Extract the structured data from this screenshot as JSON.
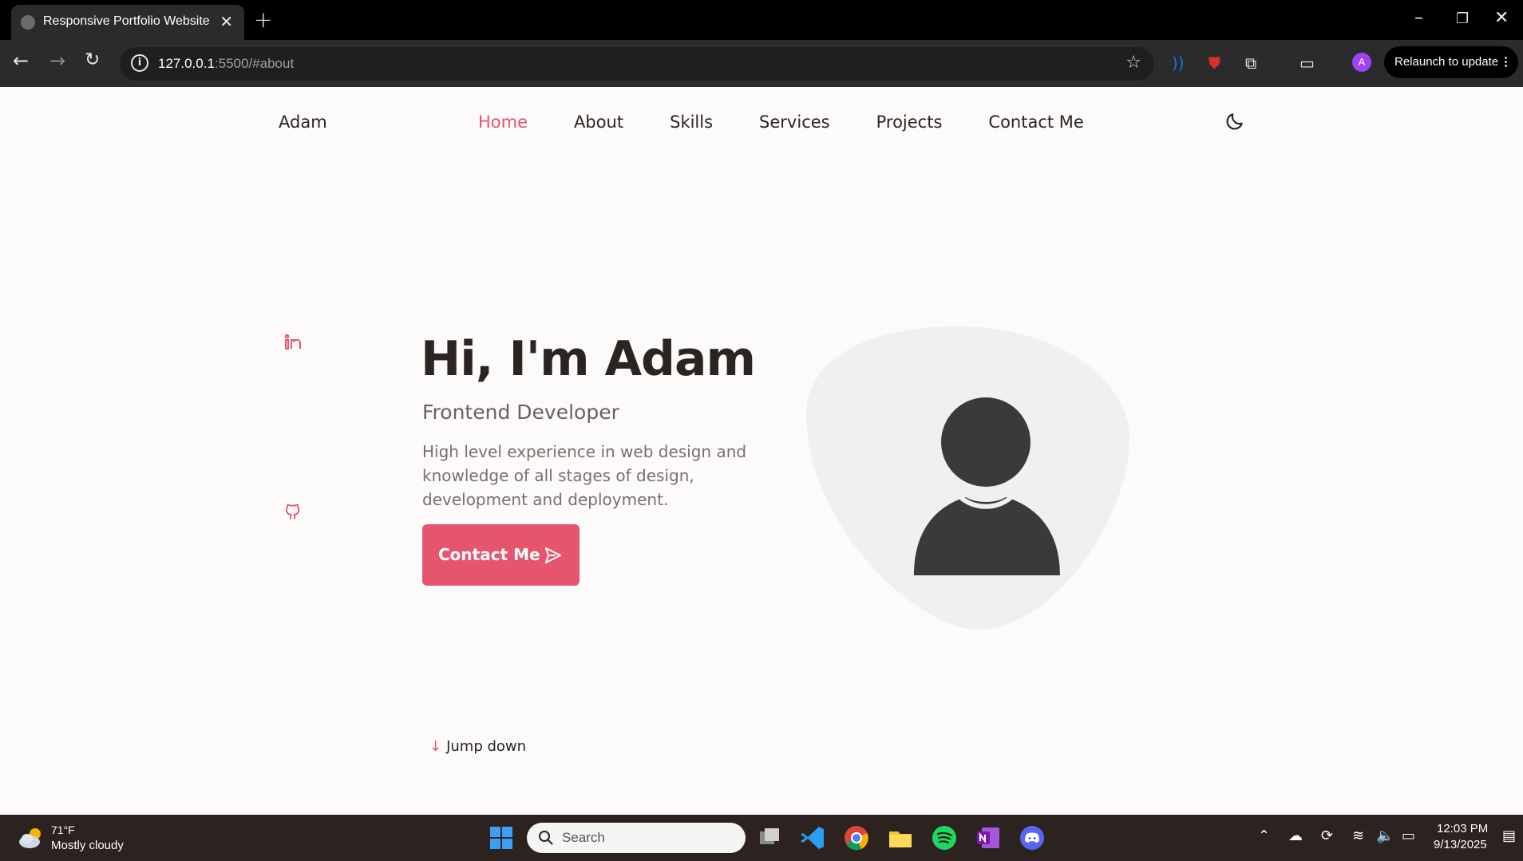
{
  "browser": {
    "tab_title": "Responsive Portfolio Website",
    "url_host": "127.0.0.1",
    "url_rest": ":5500/#about",
    "relaunch_label": "Relaunch to update",
    "profile_initial": "A"
  },
  "site": {
    "logo": "Adam",
    "nav": [
      "Home",
      "About",
      "Skills",
      "Services",
      "Projects",
      "Contact Me"
    ],
    "active_nav": "Home"
  },
  "hero": {
    "title": "Hi, I'm Adam",
    "subtitle": "Frontend Developer",
    "description": "High level experience in web design and knowledge of all stages of design, development and deployment.",
    "cta_label": "Contact Me",
    "scroll_label": "Jump down"
  },
  "taskbar": {
    "weather_temp": "71°F",
    "weather_condition": "Mostly cloudy",
    "search_placeholder": "Search",
    "time": "12:03 PM",
    "date": "9/13/2025"
  },
  "colors": {
    "accent": "#e5566e",
    "text": "#2a2523",
    "page_bg": "#fcfbfa",
    "blob": "#f1f0ee",
    "avatar": "#3a3a3a"
  }
}
